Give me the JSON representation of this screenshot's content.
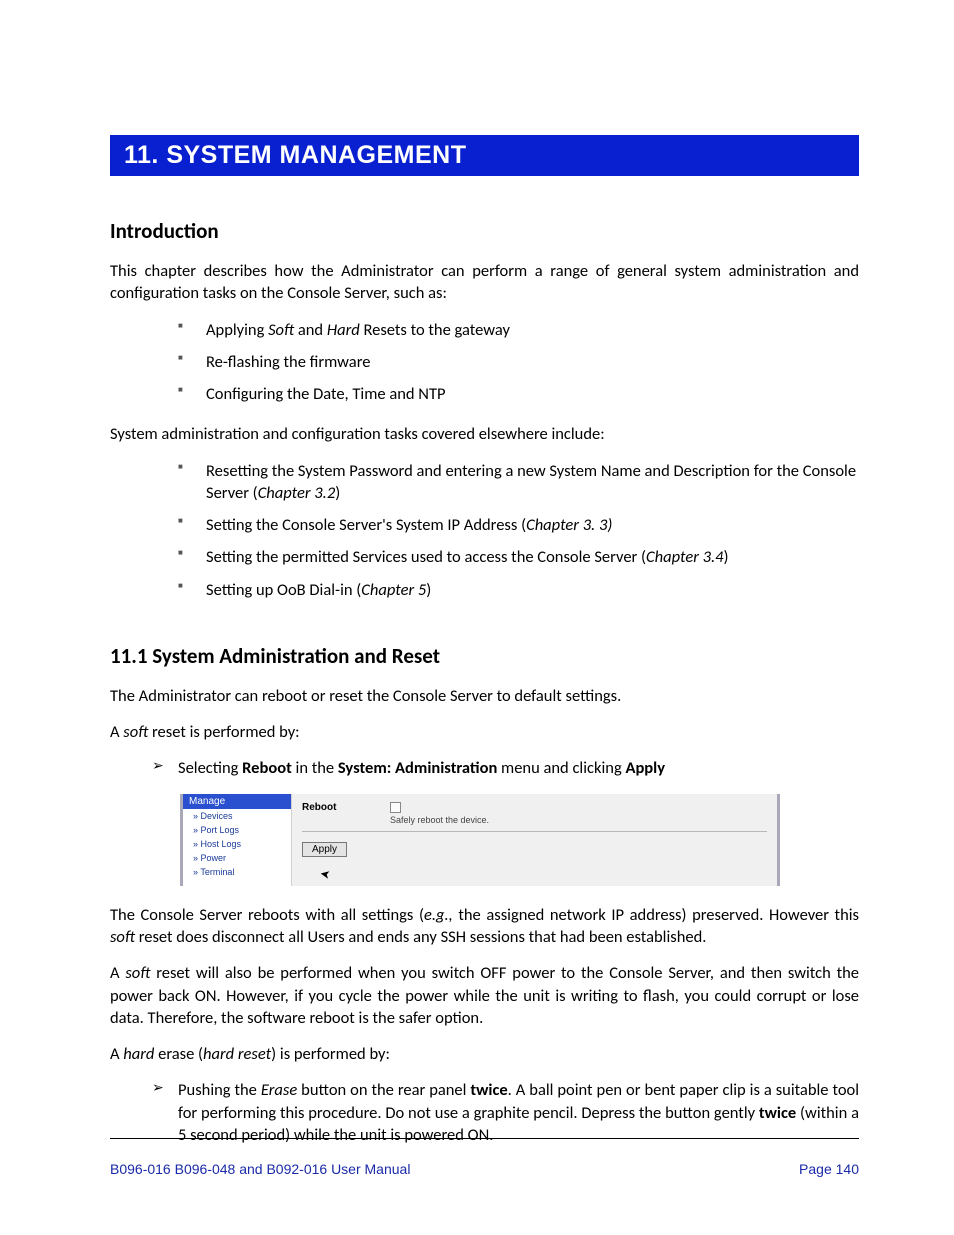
{
  "chapter": {
    "title": "11.   SYSTEM MANAGEMENT"
  },
  "intro": {
    "heading": "Introduction",
    "p1": "This chapter describes how the Administrator can perform a range of general system administration and configuration tasks on the Console Server, such as:",
    "bullets1": {
      "b1_pre": "Applying ",
      "b1_soft": "Soft",
      "b1_mid": " and ",
      "b1_hard": "Hard",
      "b1_post": " Resets to the gateway",
      "b2": "Re-flashing the firmware",
      "b3": "Configuring the Date, Time and NTP"
    },
    "p2": "System administration and configuration tasks covered elsewhere include:",
    "bullets2": {
      "b1_pre": "Resetting the System Password and entering a new System Name and Description for the Console Server (",
      "b1_ref": "Chapter 3.2",
      "b1_post": ")",
      "b2_pre": "Setting the Console Server's System IP Address (",
      "b2_ref": "Chapter 3. 3)",
      "b3_pre": "Setting the permitted Services used to access the Console Server (",
      "b3_ref": "Chapter 3.4",
      "b3_post": ")",
      "b4_pre": "Setting up OoB Dial-in (",
      "b4_ref": "Chapter 5",
      "b4_post": ")"
    }
  },
  "section11_1": {
    "heading": "11.1   System Administration and Reset",
    "p1": "The Administrator can reboot or reset the Console Server to default settings.",
    "p2_pre": "A ",
    "p2_em": "soft",
    "p2_post": " reset is performed by:",
    "arrow1_pre": "Selecting ",
    "arrow1_b1": "Reboot",
    "arrow1_mid1": " in the ",
    "arrow1_b2": "System: Administration",
    "arrow1_mid2": " menu and clicking ",
    "arrow1_b3": "Apply",
    "p3_pre": "The Console Server reboots with all settings (",
    "p3_eg": "e.g.,",
    "p3_mid": " the assigned network IP address) preserved. However this ",
    "p3_soft": "soft",
    "p3_post": " reset does disconnect all Users and ends any SSH sessions that had been established.",
    "p4_pre": "A ",
    "p4_soft": "soft",
    "p4_post": " reset will also be performed when you switch OFF power to the Console Server, and then switch the power back ON. However, if you cycle the power while the unit is writing to flash, you could corrupt or lose data. Therefore, the software reboot is the safer option.",
    "p5_pre": "A ",
    "p5_hard": "hard",
    "p5_mid": " erase (",
    "p5_hr": "hard reset",
    "p5_post": ") is performed by:",
    "arrow2_pre": "Pushing the ",
    "arrow2_em": "Erase",
    "arrow2_mid1": " button on the rear panel ",
    "arrow2_b1": "twice",
    "arrow2_mid2": ". A ball point pen or bent paper clip is a suitable tool for performing this procedure. Do not use a graphite pencil. Depress the button gently ",
    "arrow2_b2": "twice",
    "arrow2_post": " (within a 5 second period) while the unit is powered ON."
  },
  "screenshot": {
    "sidebar": {
      "header": "Manage",
      "items": [
        "Devices",
        "Port Logs",
        "Host Logs",
        "Power",
        "Terminal"
      ]
    },
    "form": {
      "reboot_label": "Reboot",
      "help": "Safely reboot the device.",
      "apply": "Apply"
    }
  },
  "footer": {
    "left": "B096-016 B096-048 and B092-016 User Manual",
    "right": "Page 140"
  }
}
